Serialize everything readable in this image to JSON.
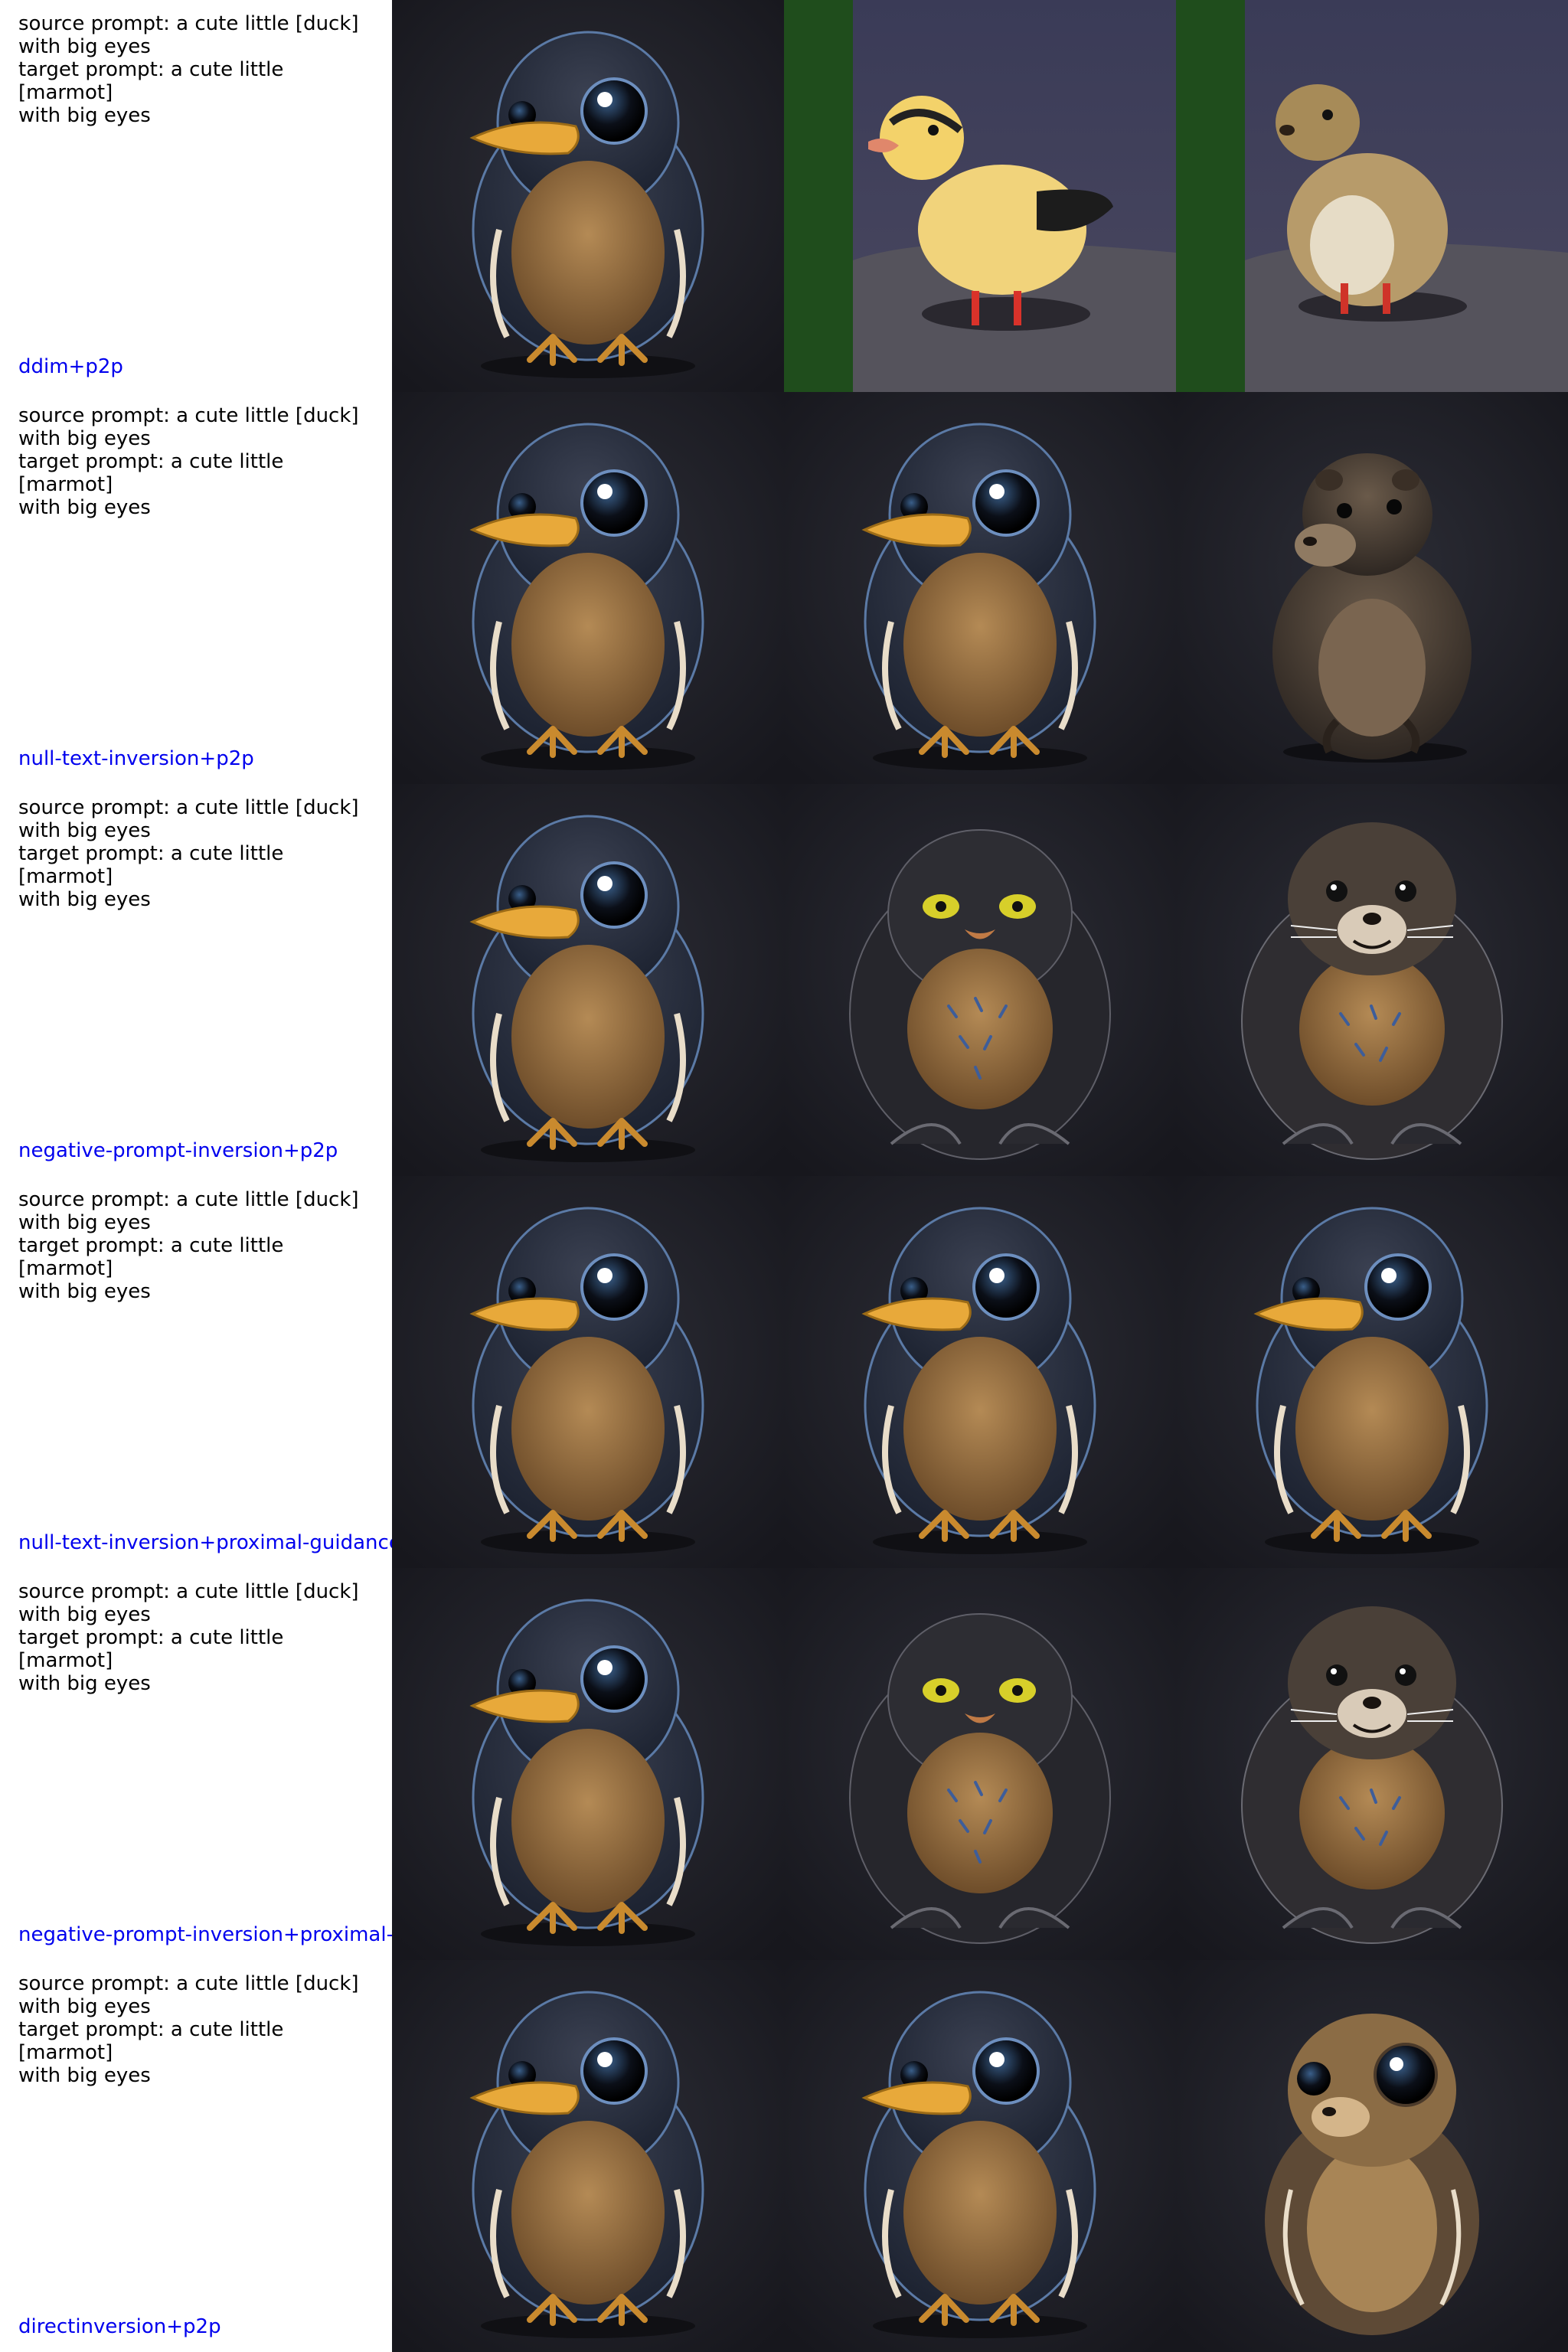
{
  "rows": [
    {
      "method": "ddim+p2p",
      "source_prompt": [
        "source prompt: a cute little [duck]",
        "with big eyes"
      ],
      "target_prompt": [
        "target prompt: a cute little [marmot]",
        "with big eyes"
      ],
      "images": [
        "source-duck-cartoon",
        "reconstruction-real-duck",
        "edited-real-marmot"
      ]
    },
    {
      "method": "null-text-inversion+p2p",
      "source_prompt": [
        "source prompt: a cute little [duck]",
        "with big eyes"
      ],
      "target_prompt": [
        "target prompt: a cute little [marmot]",
        "with big eyes"
      ],
      "images": [
        "source-duck-cartoon",
        "reconstruction-duck-cartoon",
        "edited-marmot-realistic"
      ]
    },
    {
      "method": "negative-prompt-inversion+p2p",
      "source_prompt": [
        "source prompt: a cute little [duck]",
        "with big eyes"
      ],
      "target_prompt": [
        "target prompt: a cute little [marmot]",
        "with big eyes"
      ],
      "images": [
        "source-duck-cartoon",
        "reconstruction-dark-bird",
        "edited-marmot-cartoon"
      ]
    },
    {
      "method": "null-text-inversion+proximal-guidance",
      "source_prompt": [
        "source prompt: a cute little [duck]",
        "with big eyes"
      ],
      "target_prompt": [
        "target prompt: a cute little [marmot]",
        "with big eyes"
      ],
      "images": [
        "source-duck-cartoon",
        "reconstruction-duck-cartoon",
        "edited-duck-cartoon"
      ]
    },
    {
      "method": "negative-prompt-inversion+proximal-g",
      "source_prompt": [
        "source prompt: a cute little [duck]",
        "with big eyes"
      ],
      "target_prompt": [
        "target prompt: a cute little [marmot]",
        "with big eyes"
      ],
      "images": [
        "source-duck-cartoon",
        "reconstruction-dark-bird",
        "edited-marmot-cartoon"
      ]
    },
    {
      "method": "directinversion+p2p",
      "source_prompt": [
        "source prompt: a cute little [duck]",
        "with big eyes"
      ],
      "target_prompt": [
        "target prompt: a cute little [marmot]",
        "with big eyes"
      ],
      "images": [
        "source-duck-cartoon",
        "reconstruction-duck-cartoon",
        "edited-marmot-big-eyes"
      ]
    }
  ],
  "colors": {
    "method_label": "#0000ee",
    "prompt_text": "#000000",
    "image_background": "#1f1f26"
  }
}
